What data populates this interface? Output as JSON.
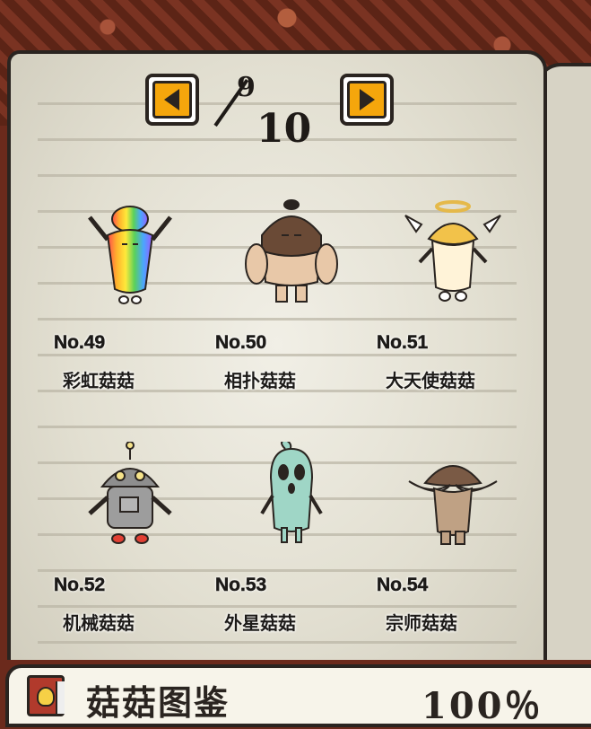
{
  "pager": {
    "current": "9",
    "total": "10",
    "prev_label": "◀",
    "next_label": "▶"
  },
  "items": [
    {
      "no": "No.49",
      "name": "彩虹菇菇",
      "icon": "rainbow-mushroom-icon"
    },
    {
      "no": "No.50",
      "name": "相扑菇菇",
      "icon": "sumo-mushroom-icon"
    },
    {
      "no": "No.51",
      "name": "大天使菇菇",
      "icon": "angel-mushroom-icon"
    },
    {
      "no": "No.52",
      "name": "机械菇菇",
      "icon": "robot-mushroom-icon"
    },
    {
      "no": "No.53",
      "name": "外星菇菇",
      "icon": "alien-mushroom-icon"
    },
    {
      "no": "No.54",
      "name": "宗师菇菇",
      "icon": "master-mushroom-icon"
    }
  ],
  "footer": {
    "title": "菇菇图鉴",
    "percent": "100％"
  },
  "colors": {
    "accent": "#f5a60c",
    "ink": "#2a2420",
    "page": "#e4e1d3"
  }
}
